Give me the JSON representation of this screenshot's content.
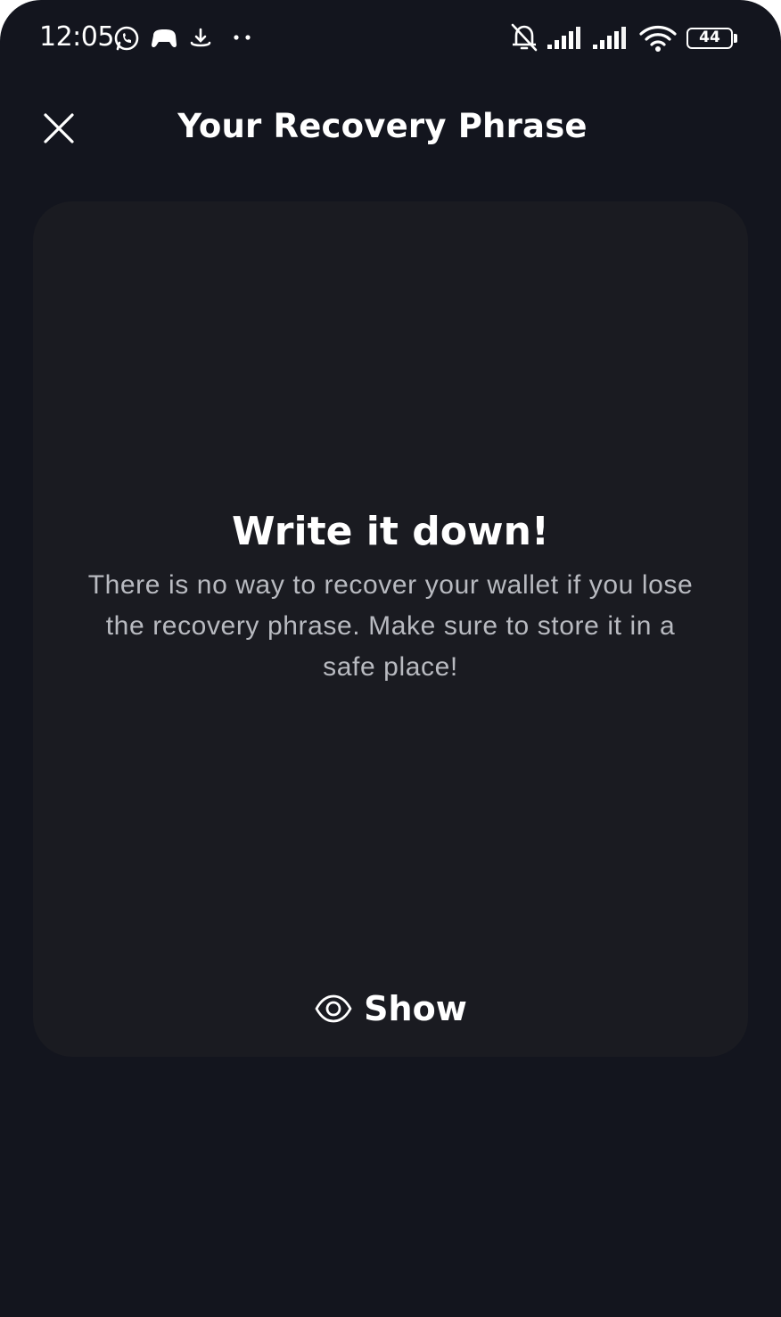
{
  "status_bar": {
    "time": "12:05",
    "battery": "44",
    "icons": [
      "whatsapp-icon",
      "game-controller-icon",
      "download-icon",
      "more-dots-icon",
      "bell-off-icon",
      "signal-icon",
      "signal-icon",
      "wifi-icon",
      "battery-icon"
    ]
  },
  "header": {
    "title": "Your Recovery Phrase",
    "close_icon": "close-icon"
  },
  "card": {
    "heading": "Write it down!",
    "body": "There is no way to recover your wallet if you lose the recovery phrase. Make sure to store it in a safe place!",
    "show_label": "Show",
    "show_icon": "eye-icon"
  },
  "colors": {
    "background": "#13151e",
    "card": "#1a1b21",
    "text_primary": "#ffffff",
    "text_secondary": "#b8bac0"
  }
}
